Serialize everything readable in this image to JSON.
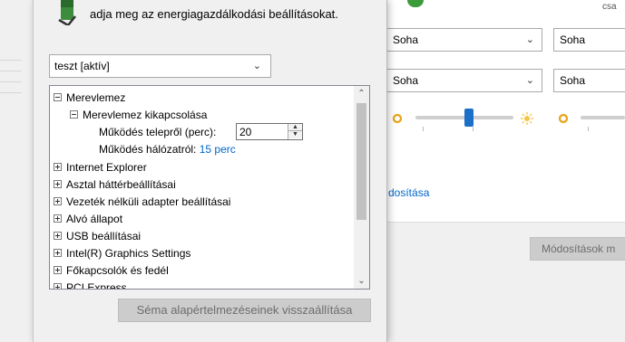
{
  "dialog": {
    "header_text": "adja meg az energiagazdálkodási beállításokat.",
    "header_icon": "power-plan-battery-icon",
    "plan_select": {
      "value": "teszt [aktív]"
    },
    "tree": {
      "rows": [
        {
          "label": "Merevlemez",
          "expanded": true,
          "level": 0
        },
        {
          "label": "Merevlemez kikapcsolása",
          "expanded": true,
          "level": 1
        },
        {
          "label": "Működés telepről (perc):",
          "level": 2,
          "value": "20"
        },
        {
          "label": "Működés hálózatról:",
          "level": 2,
          "value": "15 perc"
        },
        {
          "label": "Internet Explorer",
          "expanded": false,
          "level": 0
        },
        {
          "label": "Asztal háttérbeállításai",
          "expanded": false,
          "level": 0
        },
        {
          "label": "Vezeték nélküli adapter beállításai",
          "expanded": false,
          "level": 0
        },
        {
          "label": "Alvó állapot",
          "expanded": false,
          "level": 0
        },
        {
          "label": "USB beállításai",
          "expanded": false,
          "level": 0
        },
        {
          "label": "Intel(R) Graphics Settings",
          "expanded": false,
          "level": 0
        },
        {
          "label": "Főkapcsolók és fedél",
          "expanded": false,
          "level": 0
        },
        {
          "label": "PCI Express",
          "expanded": false,
          "level": 0
        }
      ]
    },
    "restore_button": "Séma alapértelmezéseinek visszaállítása"
  },
  "background": {
    "topright_text": "csa",
    "select_row1": [
      "Soha",
      "Soha"
    ],
    "select_row2": [
      "Soha",
      "Soha"
    ],
    "link_text": "dosítása",
    "save_button": "Módosítások m",
    "brightness_slider_level": 0.55
  },
  "colors": {
    "link": "#0066cc",
    "slider_thumb": "#1a6fc7",
    "disabled_button_bg": "#cccccc"
  }
}
